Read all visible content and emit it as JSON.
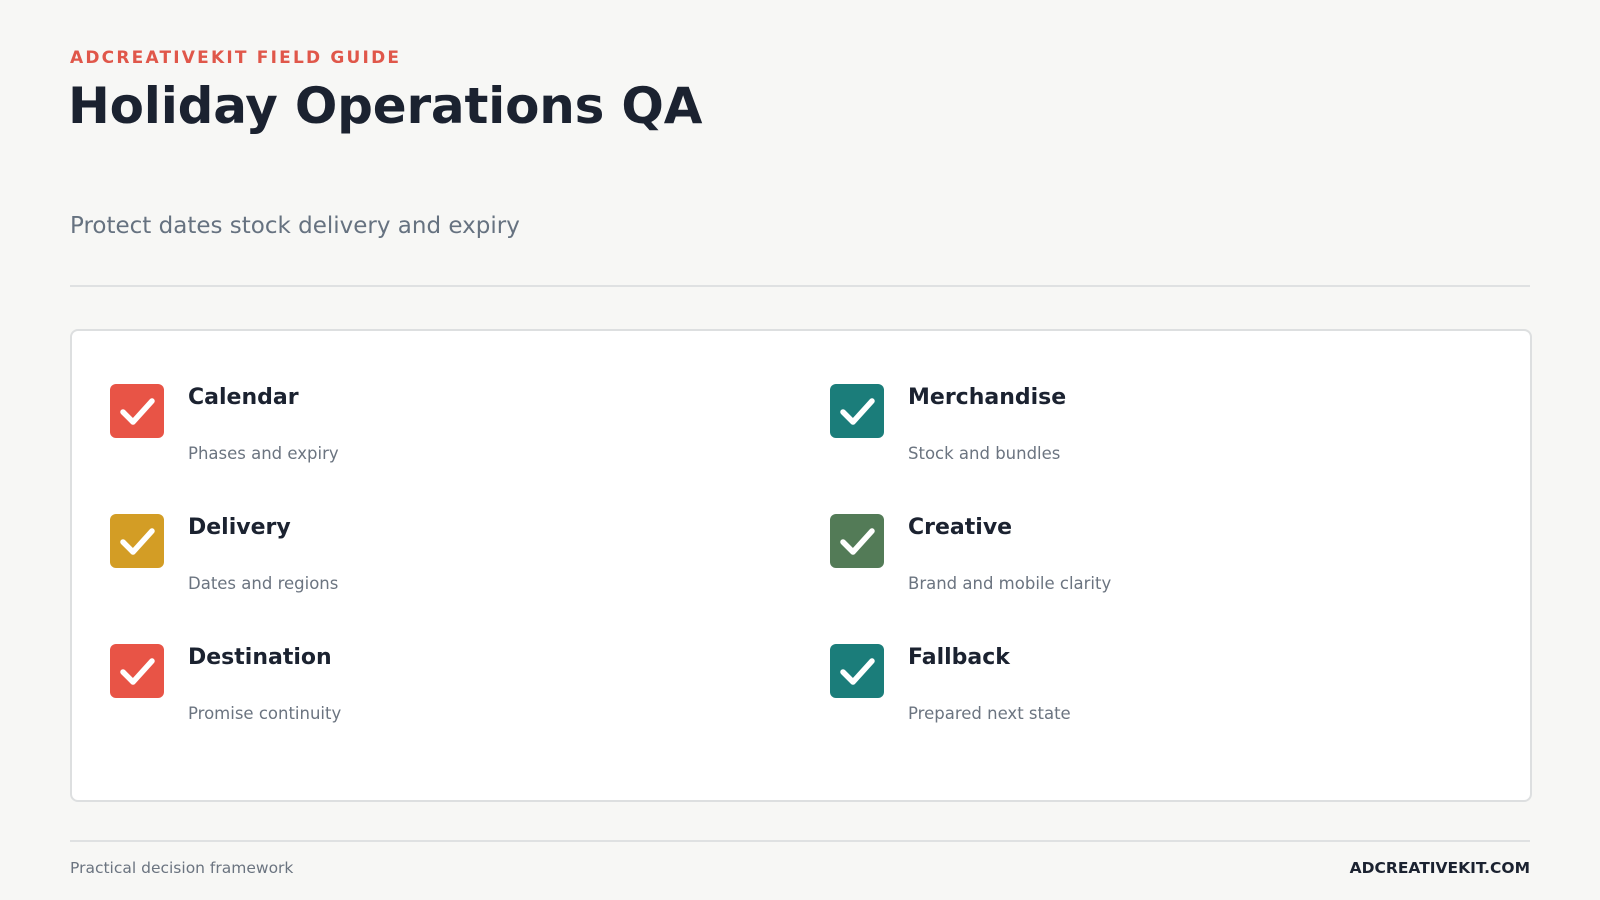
{
  "header": {
    "eyebrow": "ADCREATIVEKIT FIELD GUIDE",
    "title": "Holiday Operations QA",
    "subtitle": "Protect dates stock delivery and expiry"
  },
  "checklist": {
    "items": [
      {
        "title": "Calendar",
        "description": "Phases and expiry",
        "color": "#e85446",
        "icon": "checkmark-icon",
        "checked": true
      },
      {
        "title": "Merchandise",
        "description": "Stock and bundles",
        "color": "#1b7d7a",
        "icon": "checkmark-icon",
        "checked": true
      },
      {
        "title": "Delivery",
        "description": "Dates and regions",
        "color": "#d39d25",
        "icon": "checkmark-icon",
        "checked": true
      },
      {
        "title": "Creative",
        "description": "Brand and mobile clarity",
        "color": "#537b57",
        "icon": "checkmark-icon",
        "checked": true
      },
      {
        "title": "Destination",
        "description": "Promise continuity",
        "color": "#e85446",
        "icon": "checkmark-icon",
        "checked": true
      },
      {
        "title": "Fallback",
        "description": "Prepared next state",
        "color": "#1b7d7a",
        "icon": "checkmark-icon",
        "checked": true
      }
    ]
  },
  "footer": {
    "left": "Practical decision framework",
    "right": "ADCREATIVEKIT.COM"
  }
}
